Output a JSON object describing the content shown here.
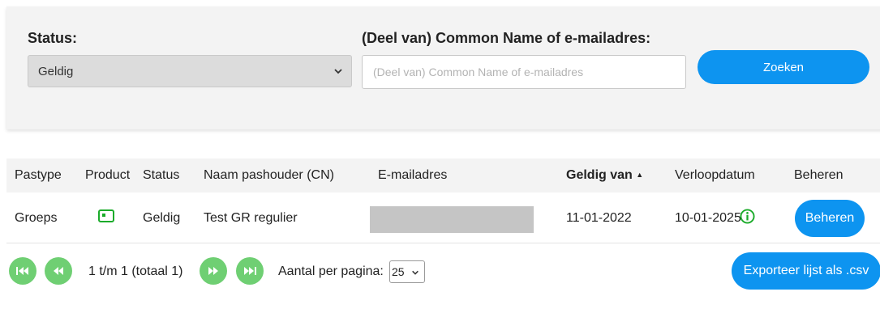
{
  "filter": {
    "status_label": "Status:",
    "status_value": "Geldig",
    "search_label": "(Deel van) Common Name of e-mailadres:",
    "search_value": "",
    "search_placeholder": "(Deel van) Common Name of e-mailadres",
    "search_button": "Zoeken"
  },
  "table": {
    "columns": [
      "Pastype",
      "Product",
      "Status",
      "Naam pashouder (CN)",
      "E-mailadres",
      "Geldig van",
      "Verloopdatum",
      "Beheren"
    ],
    "sort_indicator": "▲",
    "sorted_column": "Geldig van",
    "rows": [
      {
        "pastype": "Groeps",
        "product_icon": "card-icon",
        "status": "Geldig",
        "naam": "Test GR regulier",
        "email": "",
        "geldig_van": "11-01-2022",
        "verloopdatum": "10-01-2025",
        "info_icon": "info-circle-icon",
        "action": "Beheren"
      }
    ]
  },
  "pagination": {
    "range_text": "1 t/m 1 (totaal 1)",
    "per_page_label": "Aantal per pagina:",
    "per_page_value": "25",
    "icons": [
      "first-page-icon",
      "previous-page-icon",
      "next-page-icon",
      "last-page-icon"
    ]
  },
  "export_button": "Exporteer lijst als .csv",
  "colors": {
    "primary": "#0d94f0",
    "pager": "#6fcf73",
    "valid_green": "#1bab2a",
    "panel_bg": "#f3f3f3"
  }
}
